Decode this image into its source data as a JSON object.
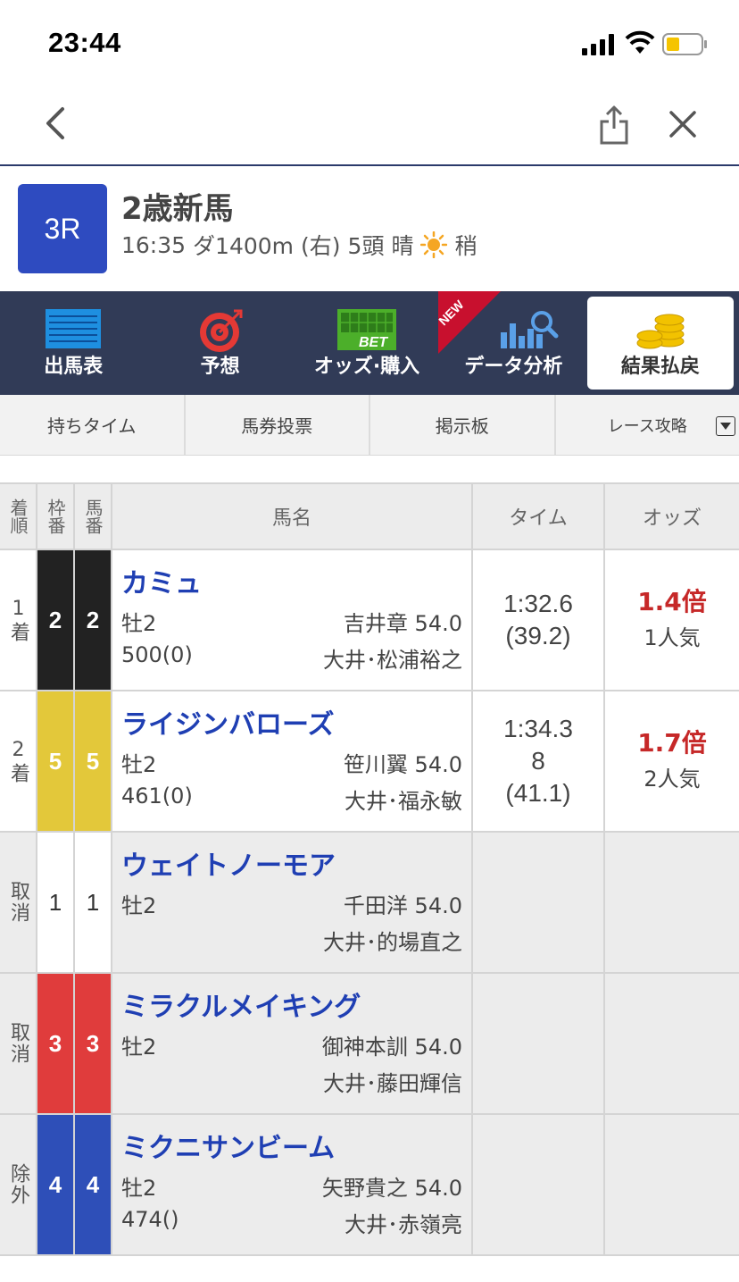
{
  "status_bar": {
    "time": "23:44",
    "battery_color": "#f5c400"
  },
  "race": {
    "number": "3R",
    "name": "2歳新馬",
    "time": "16:35",
    "course": "ダ1400m",
    "direction": "(右)",
    "runners": "5頭",
    "weather": "晴",
    "track": "稍"
  },
  "menu": [
    {
      "label": "出馬表",
      "icon": "entry-table-icon"
    },
    {
      "label": "予想",
      "icon": "target-icon"
    },
    {
      "label": "オッズ·購入",
      "icon": "bet-icon"
    },
    {
      "label": "データ分析",
      "icon": "data-analysis-icon",
      "badge": "NEW"
    },
    {
      "label": "結果払戻",
      "icon": "coins-icon",
      "active": true
    }
  ],
  "subtabs": [
    {
      "label": "持ちタイム"
    },
    {
      "label": "馬券投票"
    },
    {
      "label": "掲示板"
    },
    {
      "label": "レース攻略"
    }
  ],
  "table": {
    "headers": {
      "rank": "着順",
      "frame": "枠番",
      "horse_no": "馬番",
      "name": "馬名",
      "time": "タイム",
      "odds": "オッズ"
    },
    "rows": [
      {
        "rank": "1着",
        "frame": "2",
        "horse_no": "2",
        "frame_color": "#222222",
        "text_color": "#ffffff",
        "name": "カミュ",
        "sex_age": "牡2",
        "jockey": "吉井章 54.0",
        "weight": "500(0)",
        "trainer": "大井･松浦裕之",
        "time": "1:32.6",
        "margin": "",
        "last3f": "(39.2)",
        "odds": "1.4倍",
        "popularity": "1人気"
      },
      {
        "rank": "2着",
        "frame": "5",
        "horse_no": "5",
        "frame_color": "#e3c83a",
        "text_color": "#ffffff",
        "name": "ライジンバローズ",
        "sex_age": "牡2",
        "jockey": "笹川翼 54.0",
        "weight": "461(0)",
        "trainer": "大井･福永敏",
        "time": "1:34.3",
        "margin": "8",
        "last3f": "(41.1)",
        "odds": "1.7倍",
        "popularity": "2人気"
      },
      {
        "rank": "取消",
        "frame": "1",
        "horse_no": "1",
        "frame_color": "#ffffff",
        "text_color": "#333333",
        "name": "ウェイトノーモア",
        "sex_age": "牡2",
        "jockey": "千田洋 54.0",
        "weight": "",
        "trainer": "大井･的場直之",
        "time": "",
        "margin": "",
        "last3f": "",
        "odds": "",
        "popularity": ""
      },
      {
        "rank": "取消",
        "frame": "3",
        "horse_no": "3",
        "frame_color": "#e03c3c",
        "text_color": "#ffffff",
        "name": "ミラクルメイキング",
        "sex_age": "牡2",
        "jockey": "御神本訓 54.0",
        "weight": "",
        "trainer": "大井･藤田輝信",
        "time": "",
        "margin": "",
        "last3f": "",
        "odds": "",
        "popularity": ""
      },
      {
        "rank": "除外",
        "frame": "4",
        "horse_no": "4",
        "frame_color": "#2e4fb8",
        "text_color": "#ffffff",
        "name": "ミクニサンビーム",
        "sex_age": "牡2",
        "jockey": "矢野貴之 54.0",
        "weight": "474()",
        "trainer": "大井･赤嶺亮",
        "time": "",
        "margin": "",
        "last3f": "",
        "odds": "",
        "popularity": ""
      }
    ]
  }
}
